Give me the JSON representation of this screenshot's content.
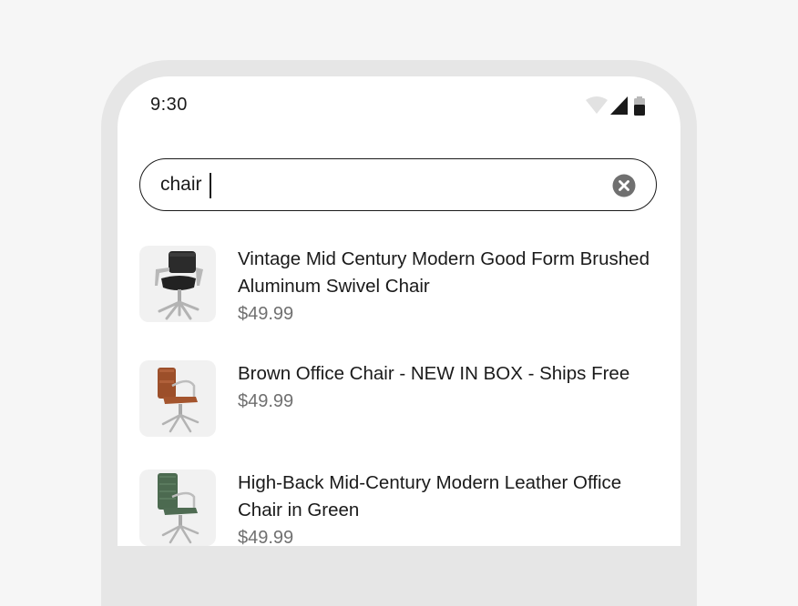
{
  "status_bar": {
    "time": "9:30"
  },
  "search": {
    "value": "chair",
    "placeholder": ""
  },
  "results": [
    {
      "title": "Vintage Mid Century Modern Good Form Brushed Aluminum Swivel Chair",
      "price": "$49.99",
      "image": "black-leather-swivel-chair"
    },
    {
      "title": "Brown Office Chair - NEW IN BOX - Ships Free",
      "price": "$49.99",
      "image": "brown-office-chair"
    },
    {
      "title": "High-Back Mid-Century Modern Leather Office Chair in Green",
      "price": "$49.99",
      "image": "green-office-chair"
    }
  ],
  "colors": {
    "background": "#f6f6f6",
    "frame": "#e6e6e6",
    "text": "#1a1a1a",
    "price": "#707070",
    "thumb_bg": "#f1f1f1"
  }
}
